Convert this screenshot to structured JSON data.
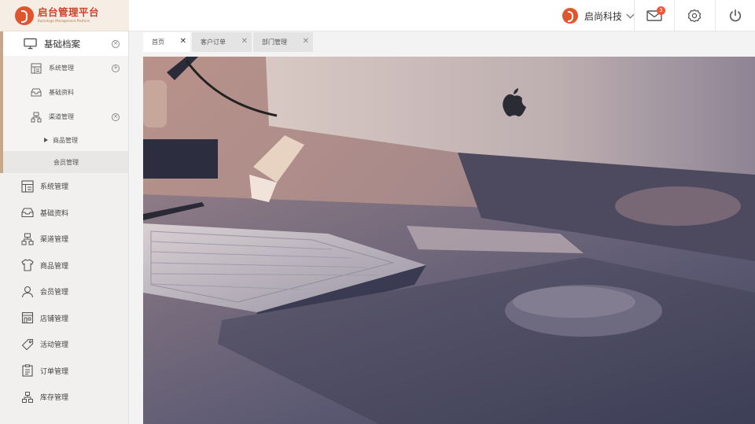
{
  "brand": {
    "title": "启台管理平台",
    "subtitle": "Backstage Management Platform"
  },
  "header": {
    "company": "启尚科技",
    "mail_badge": "3"
  },
  "sidebar": {
    "group": {
      "label": "基础档案",
      "children": [
        {
          "label": "系统管理",
          "icon": "dashboard-icon",
          "toggle": "+"
        },
        {
          "label": "基础资料",
          "icon": "inbox-icon"
        },
        {
          "label": "渠道管理",
          "icon": "channel-icon",
          "toggle": "×"
        }
      ],
      "nested": [
        {
          "label": "商品管理"
        },
        {
          "label": "会员管理"
        }
      ]
    },
    "items": [
      {
        "label": "系统管理",
        "icon": "dashboard-icon"
      },
      {
        "label": "基础资料",
        "icon": "inbox-icon"
      },
      {
        "label": "渠道管理",
        "icon": "channel-icon"
      },
      {
        "label": "商品管理",
        "icon": "shirt-icon"
      },
      {
        "label": "会员管理",
        "icon": "user-icon"
      },
      {
        "label": "店铺管理",
        "icon": "store-icon"
      },
      {
        "label": "活动管理",
        "icon": "tag-icon"
      },
      {
        "label": "订单管理",
        "icon": "order-icon"
      },
      {
        "label": "库存管理",
        "icon": "warehouse-icon"
      }
    ]
  },
  "tabs": [
    {
      "label": "首页",
      "active": true
    },
    {
      "label": "客户订单",
      "active": false
    },
    {
      "label": "部门管理",
      "active": false
    }
  ],
  "colors": {
    "brand": "#e0552e",
    "accent_bar": "#c4a889",
    "badge": "#f0553a"
  }
}
